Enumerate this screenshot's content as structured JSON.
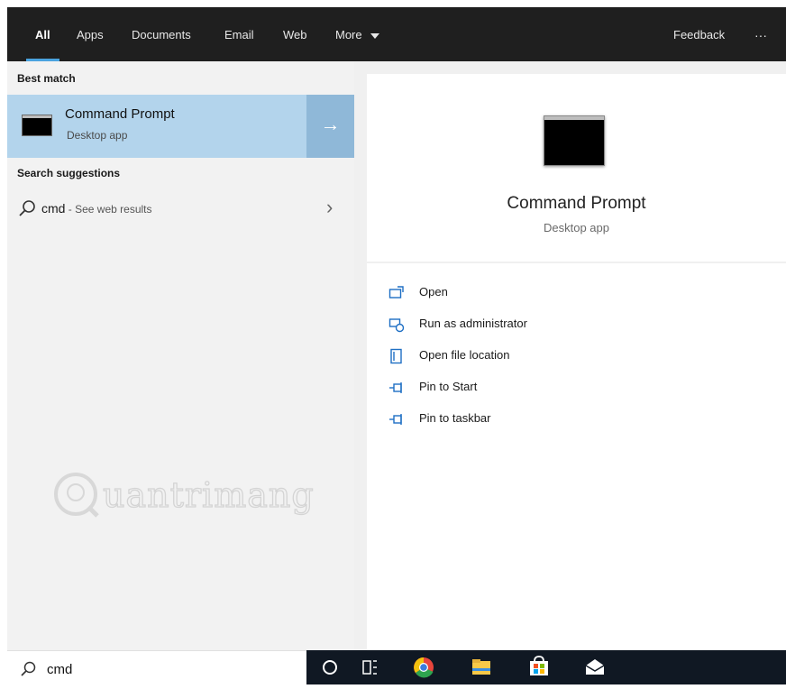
{
  "tabs": [
    {
      "label": "All"
    },
    {
      "label": "Apps"
    },
    {
      "label": "Documents"
    },
    {
      "label": "Email"
    },
    {
      "label": "Web"
    },
    {
      "label": "More"
    }
  ],
  "feedback_label": "Feedback",
  "overflow_label": "···",
  "best_match": {
    "heading": "Best match",
    "title": "Command Prompt",
    "subtitle": "Desktop app",
    "arrow": "→"
  },
  "suggestions": {
    "heading": "Search suggestions",
    "query": "cmd",
    "suffix": " - See web results",
    "chevron": "›"
  },
  "preview": {
    "title": "Command Prompt",
    "subtitle": "Desktop app"
  },
  "actions": [
    {
      "label": "Open",
      "icon": "open-icon"
    },
    {
      "label": "Run as administrator",
      "icon": "run-as-admin-icon"
    },
    {
      "label": "Open file location",
      "icon": "file-location-icon"
    },
    {
      "label": "Pin to Start",
      "icon": "pin-icon"
    },
    {
      "label": "Pin to taskbar",
      "icon": "pin-icon"
    }
  ],
  "search": {
    "value": "cmd"
  },
  "watermark": "Quantrimang",
  "taskbar": [
    "cortana-icon",
    "task-view-icon",
    "chrome-icon",
    "file-explorer-icon",
    "store-icon",
    "mail-icon"
  ],
  "colors": {
    "accent": "#4aa3df",
    "selected": "#b3d4ec",
    "taskbar": "#101823"
  }
}
